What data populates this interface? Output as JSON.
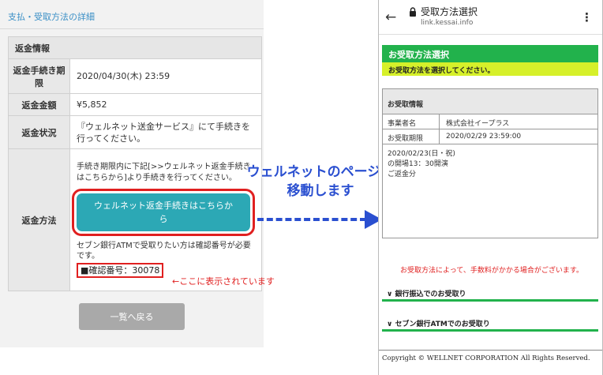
{
  "left": {
    "title": "支払・受取方法の詳細",
    "section_header": "返金情報",
    "rows": {
      "deadline": {
        "label": "返金手続き期限",
        "value": "2020/04/30(木) 23:59"
      },
      "amount": {
        "label": "返金金額",
        "value": "¥5,852"
      },
      "status": {
        "label": "返金状況",
        "value": "『ウェルネット送金サービス』にて手続きを行ってください。"
      },
      "method": {
        "label": "返金方法",
        "text": "手続き期限内に下記[>>ウェルネット返金手続きはこちらから]より手続きを行ってください。",
        "button_label": "ウェルネット返金手続きはこちらから",
        "seven_text": "セブン銀行ATMで受取りたい方は確認番号が必要です。",
        "confirm_label": "■確認番号：30078"
      }
    },
    "back_button": "一覧へ戻る",
    "annotation": "←ここに表示されています"
  },
  "overlay": {
    "line1": "ウェルネットのページに",
    "line2": "移動します"
  },
  "phone": {
    "page_title": "受取方法選択",
    "url": "link.kessai.info",
    "heading": "お受取方法選択",
    "subheading": "お受取方法を選択してください。",
    "box": {
      "title": "お受取情報",
      "rows": [
        {
          "key": "事業者名",
          "value": "株式会社イープラス"
        },
        {
          "key": "お受取期限",
          "value": "2020/02/29 23:59:00"
        }
      ],
      "note1": "2020/02/23(日・祝)",
      "note2": "の開場13：30開演",
      "note3": "ご返金分"
    },
    "warning": "お受取方法によって、手数料がかかる場合がございます。",
    "options": [
      "∨ 銀行振込でのお受取り",
      "∨ セブン銀行ATMでのお受取り"
    ],
    "footer": "Copyright © WELLNET CORPORATION All Rights Reserved."
  },
  "colors": {
    "button_teal": "#2ca8b5",
    "highlight_red": "#e02020",
    "arrow_blue": "#2a4fd0",
    "phone_green": "#22b24c",
    "phone_yellow": "#d6f02a"
  }
}
